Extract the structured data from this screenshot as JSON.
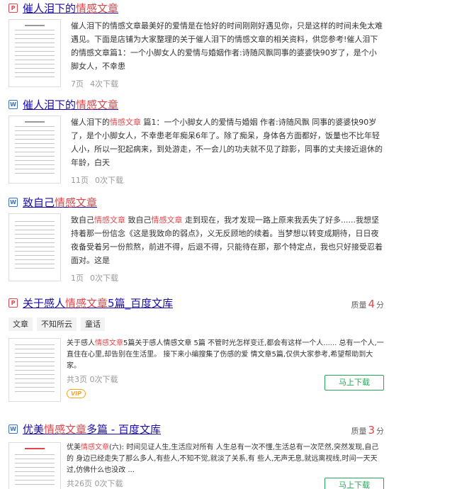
{
  "results": [
    {
      "title_pre": "催人泪下的",
      "title_hl": "情感文章",
      "title_post": "",
      "desc": "催人泪下的情感文章最美好的爱情是在恰好的时间刚刚好遇见你，只是这样的时间未免太难遇见。下面是店铺为大家整理的关于催人泪下的情感文章的相关资料，供您参考!催人泪下的情感文章篇1：一个小脚女人的爱情与婚姻作者:诗随风飘同事的婆婆快90岁了，是个小脚女人，不幸患",
      "pages": "7页",
      "downloads": "4次下载"
    },
    {
      "title_pre": "催人泪下的",
      "title_hl": "情感文章",
      "title_post": "",
      "desc_pre": "催人泪下的",
      "desc_hl": "情感文章",
      "desc_post": " 篇1：一个小脚女人的爱情与婚姻 作者:诗随风飘 同事的婆婆快90岁了，是个小脚女人，不幸患老年痴呆6年了。除了痴呆，身体各方面都好，饭量也不比年轻人小，所以一犯起病来，到处游走，不一会儿的功夫就不见了踪影，同事的丈夫接近退休的年龄，白天",
      "pages": "11页",
      "downloads": "0次下载"
    },
    {
      "title_pre": "致自己",
      "title_hl": "情感文章",
      "title_post": "",
      "desc_a": "致自己",
      "desc_hl1": "情感文章",
      "desc_b": " 致自己",
      "desc_hl2": "情感文章",
      "desc_c": " 走到现在，我才发现一路上原来我丢失了好多......我想坚持着那一份信念《这是我致命的弱点》，义无反顾地的续着。当梦想以转变成期待，日日夜夜备受着另一份煎熬，前进不得，后退不得，只能待在那，那个特定点，我也只好接受忍着面对。这是",
      "pages": "1页",
      "downloads": "0次下载"
    },
    {
      "title_pre": "关于感人",
      "title_hl": "情感文章",
      "title_post": "5篇_百度文库",
      "quality_label": "质量",
      "quality_score": "4",
      "quality_unit": "分",
      "tags": [
        "文章",
        "不知所云",
        "童话"
      ],
      "desc_pre": "关于感人",
      "desc_hl": "情感文章",
      "desc_post": "5篇关于感人情感文章 5篇 不管时光怎样变迁,都会有这样一个人...... 总有一个人,一直住在心里,却告别在生活里。 接下来小编搜集了伤感的爱 情文章5篇,仅供大家参考,希望帮助到大家。",
      "meta": "共3页  0次下载",
      "download_label": "马上下载",
      "vip": "VIP"
    },
    {
      "title_pre": "优美",
      "title_hl": "情感文章",
      "title_post": "多篇 - 百度文库",
      "quality_label": "质量",
      "quality_score": "3",
      "quality_unit": "分",
      "desc_pre": "优美",
      "desc_hl": "情感文章",
      "desc_post": "(六): 时间见证人生,生活应对所有 人生总有一次不懂,生活总有一次茫然,突然发现,自己的 身边已经走失了那么多人,有些人,不知不觉,就淡了关系,有 些人,无声无息,就远离视线,时间一天天过,仿佛什么也没改 ...",
      "meta": "共26页  0次下载",
      "download_label": "马上下载"
    }
  ],
  "icons": {
    "pdf": "pdf-icon",
    "word": "word-icon"
  },
  "colors": {
    "link": "#1a0dab",
    "highlight": "#e0474c",
    "download": "#27a65a",
    "vip": "#f5a623"
  }
}
